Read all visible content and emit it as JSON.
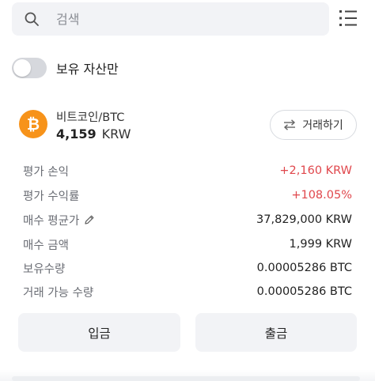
{
  "search": {
    "placeholder": "검색"
  },
  "filter": {
    "label": "보유 자산만",
    "enabled": false
  },
  "asset": {
    "name": "비트코인/BTC",
    "holding_value": "4,159",
    "holding_unit": "KRW",
    "trade_label": "거래하기",
    "colors": {
      "logo": "#f7931a"
    }
  },
  "stats": [
    {
      "label": "평가 손익",
      "value": "+2,160 KRW"
    },
    {
      "label": "평가 수익률",
      "value": "+108.05%"
    },
    {
      "label": "매수 평균가",
      "value": "37,829,000 KRW"
    },
    {
      "label": "매수 금액",
      "value": "1,999 KRW"
    },
    {
      "label": "보유수량",
      "value": "0.00005286 BTC"
    },
    {
      "label": "거래 가능 수량",
      "value": "0.00005286 BTC"
    }
  ],
  "actions": {
    "deposit": "입금",
    "withdraw": "출금"
  },
  "colors": {
    "positive": "#e0474c",
    "surface": "#f2f3f6"
  }
}
